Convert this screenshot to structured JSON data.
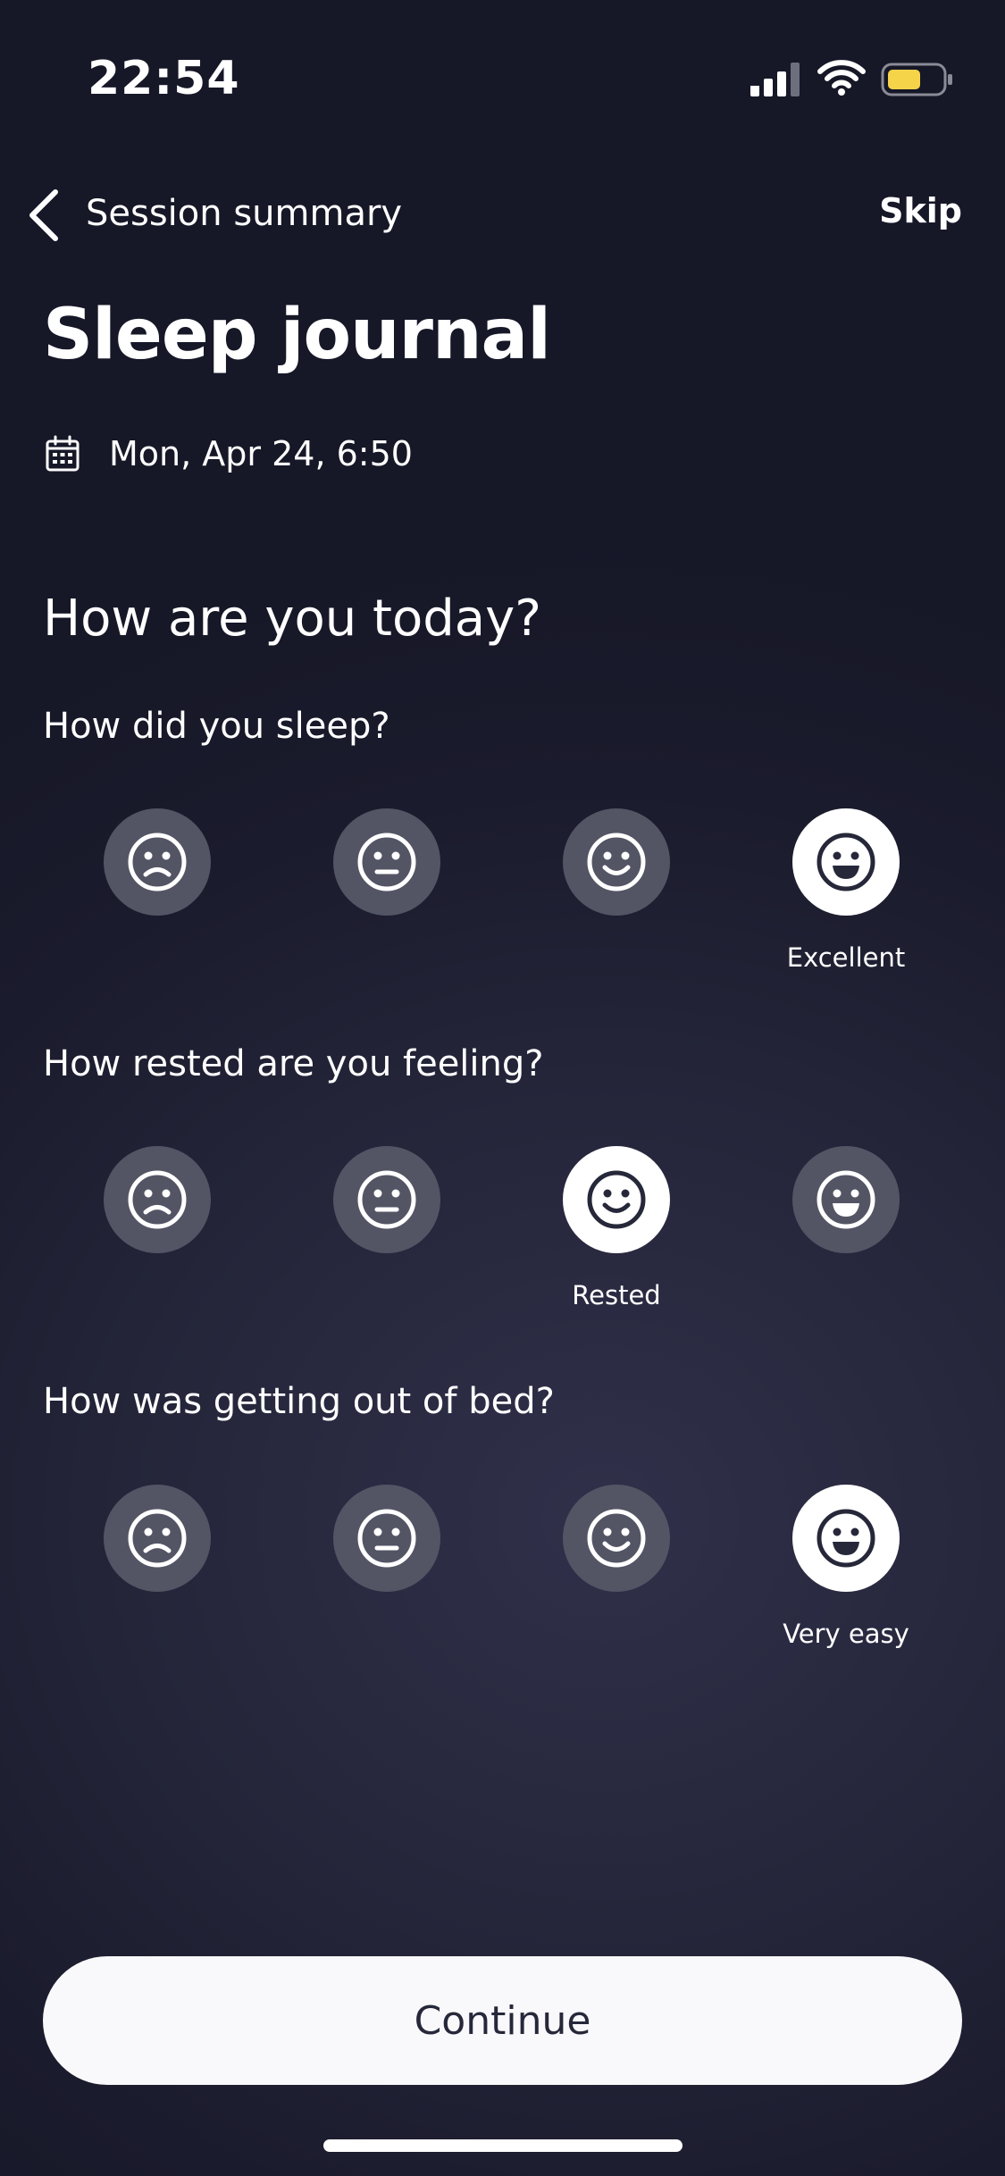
{
  "status_bar": {
    "time": "22:54",
    "battery_color": "#f5d44a"
  },
  "nav": {
    "back_label": "Session summary",
    "skip_label": "Skip"
  },
  "page": {
    "title": "Sleep journal",
    "date": "Mon, Apr 24, 6:50",
    "heading": "How are you today?"
  },
  "questions": [
    {
      "text": "How did you sleep?",
      "selected_index": 3,
      "selected_label": "Excellent"
    },
    {
      "text": "How rested are you feeling?",
      "selected_index": 2,
      "selected_label": "Rested"
    },
    {
      "text": "How was getting out of bed?",
      "selected_index": 3,
      "selected_label": "Very easy"
    }
  ],
  "face_icons": [
    "frown-face-icon",
    "neutral-face-icon",
    "smile-face-icon",
    "grin-face-icon"
  ],
  "colors": {
    "face_inactive_bg": "#535565",
    "face_active_bg": "#ffffff",
    "face_inactive_fg": "#ffffff",
    "face_active_fg": "#26283a"
  },
  "footer": {
    "continue_label": "Continue"
  }
}
